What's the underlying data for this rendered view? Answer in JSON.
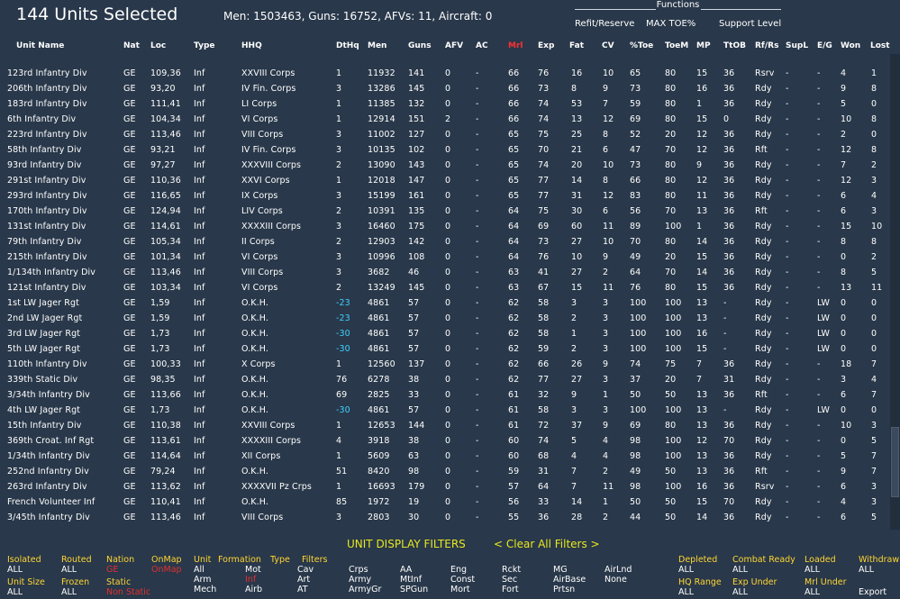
{
  "header": {
    "title": "144 Units Selected",
    "stats": "Men: 1503463, Guns: 16752, AFVs: 11, Aircraft: 0",
    "functions_label": "Functions",
    "functions": [
      "Refit/Reserve",
      "MAX TOE%",
      "Support Level"
    ]
  },
  "columns": [
    "Unit Name",
    "Nat",
    "Loc",
    "Type",
    "HHQ",
    "DtHq",
    "Men",
    "Guns",
    "AFV",
    "AC",
    "Mrl",
    "Exp",
    "Fat",
    "CV",
    "%Toe",
    "ToeM",
    "MP",
    "TtOB",
    "Rf/Rs",
    "SupL",
    "E/G",
    "Won",
    "Lost"
  ],
  "sorted_column": "Mrl",
  "rows": [
    [
      "123rd Infantry Div",
      "GE",
      "109,36",
      "Inf",
      "XXVIII Corps",
      "1",
      "11932",
      "141",
      "0",
      "-",
      "66",
      "76",
      "16",
      "10",
      "65",
      "80",
      "15",
      "36",
      "Rsrv",
      "-",
      "-",
      "4",
      "1"
    ],
    [
      "206th Infantry Div",
      "GE",
      "93,20",
      "Inf",
      "IV Fin. Corps",
      "3",
      "13286",
      "145",
      "0",
      "-",
      "66",
      "73",
      "8",
      "9",
      "73",
      "80",
      "16",
      "36",
      "Rdy",
      "-",
      "-",
      "9",
      "8"
    ],
    [
      "183rd Infantry Div",
      "GE",
      "111,41",
      "Inf",
      "LI Corps",
      "1",
      "11385",
      "132",
      "0",
      "-",
      "66",
      "74",
      "53",
      "7",
      "59",
      "80",
      "1",
      "36",
      "Rdy",
      "-",
      "-",
      "5",
      "0"
    ],
    [
      "6th Infantry Div",
      "GE",
      "104,34",
      "Inf",
      "VI Corps",
      "1",
      "12914",
      "151",
      "2",
      "-",
      "66",
      "74",
      "13",
      "12",
      "69",
      "80",
      "15",
      "0",
      "Rdy",
      "-",
      "-",
      "10",
      "8"
    ],
    [
      "223rd Infantry Div",
      "GE",
      "113,46",
      "Inf",
      "VIII Corps",
      "3",
      "11002",
      "127",
      "0",
      "-",
      "65",
      "75",
      "25",
      "8",
      "52",
      "20",
      "12",
      "36",
      "Rdy",
      "-",
      "-",
      "2",
      "0"
    ],
    [
      "58th Infantry Div",
      "GE",
      "93,21",
      "Inf",
      "IV Fin. Corps",
      "3",
      "10135",
      "102",
      "0",
      "-",
      "65",
      "70",
      "21",
      "6",
      "47",
      "70",
      "12",
      "36",
      "Rft",
      "-",
      "-",
      "12",
      "8"
    ],
    [
      "93rd Infantry Div",
      "GE",
      "97,27",
      "Inf",
      "XXXVIII Corps",
      "2",
      "13090",
      "143",
      "0",
      "-",
      "65",
      "74",
      "20",
      "10",
      "73",
      "80",
      "9",
      "36",
      "Rdy",
      "-",
      "-",
      "7",
      "2"
    ],
    [
      "291st Infantry Div",
      "GE",
      "110,36",
      "Inf",
      "XXVI Corps",
      "1",
      "12018",
      "147",
      "0",
      "-",
      "65",
      "77",
      "14",
      "8",
      "66",
      "80",
      "12",
      "36",
      "Rdy",
      "-",
      "-",
      "12",
      "3"
    ],
    [
      "293rd Infantry Div",
      "GE",
      "116,65",
      "Inf",
      "IX Corps",
      "3",
      "15199",
      "161",
      "0",
      "-",
      "65",
      "77",
      "31",
      "12",
      "83",
      "80",
      "11",
      "36",
      "Rdy",
      "-",
      "-",
      "6",
      "4"
    ],
    [
      "170th Infantry Div",
      "GE",
      "124,94",
      "Inf",
      "LIV Corps",
      "2",
      "10391",
      "135",
      "0",
      "-",
      "64",
      "75",
      "30",
      "6",
      "56",
      "70",
      "13",
      "36",
      "Rft",
      "-",
      "-",
      "6",
      "3"
    ],
    [
      "131st Infantry Div",
      "GE",
      "114,61",
      "Inf",
      "XXXXIII Corps",
      "3",
      "16460",
      "175",
      "0",
      "-",
      "64",
      "69",
      "60",
      "11",
      "89",
      "100",
      "1",
      "36",
      "Rdy",
      "-",
      "-",
      "15",
      "10"
    ],
    [
      "79th Infantry Div",
      "GE",
      "105,34",
      "Inf",
      "II Corps",
      "2",
      "12903",
      "142",
      "0",
      "-",
      "64",
      "73",
      "27",
      "10",
      "70",
      "80",
      "14",
      "36",
      "Rdy",
      "-",
      "-",
      "8",
      "8"
    ],
    [
      "215th Infantry Div",
      "GE",
      "101,34",
      "Inf",
      "VI Corps",
      "3",
      "10996",
      "108",
      "0",
      "-",
      "64",
      "76",
      "10",
      "9",
      "49",
      "20",
      "15",
      "36",
      "Rdy",
      "-",
      "-",
      "0",
      "2"
    ],
    [
      "1/134th Infantry Div",
      "GE",
      "113,46",
      "Inf",
      "VIII Corps",
      "3",
      "3682",
      "46",
      "0",
      "-",
      "63",
      "41",
      "27",
      "2",
      "64",
      "70",
      "14",
      "36",
      "Rdy",
      "-",
      "-",
      "8",
      "5"
    ],
    [
      "121st Infantry Div",
      "GE",
      "103,34",
      "Inf",
      "VI Corps",
      "2",
      "13249",
      "145",
      "0",
      "-",
      "63",
      "67",
      "15",
      "11",
      "76",
      "80",
      "15",
      "36",
      "Rdy",
      "-",
      "-",
      "13",
      "11"
    ],
    [
      "1st LW Jager Rgt",
      "GE",
      "1,59",
      "Inf",
      "O.K.H.",
      "-23",
      "4861",
      "57",
      "0",
      "-",
      "62",
      "58",
      "3",
      "3",
      "100",
      "100",
      "13",
      "-",
      "Rdy",
      "-",
      "LW",
      "0",
      "0"
    ],
    [
      "2nd LW Jager Rgt",
      "GE",
      "1,59",
      "Inf",
      "O.K.H.",
      "-23",
      "4861",
      "57",
      "0",
      "-",
      "62",
      "58",
      "2",
      "3",
      "100",
      "100",
      "13",
      "-",
      "Rdy",
      "-",
      "LW",
      "0",
      "0"
    ],
    [
      "3rd LW Jager Rgt",
      "GE",
      "1,73",
      "Inf",
      "O.K.H.",
      "-30",
      "4861",
      "57",
      "0",
      "-",
      "62",
      "58",
      "1",
      "3",
      "100",
      "100",
      "16",
      "-",
      "Rdy",
      "-",
      "LW",
      "0",
      "0"
    ],
    [
      "5th LW Jager Rgt",
      "GE",
      "1,73",
      "Inf",
      "O.K.H.",
      "-30",
      "4861",
      "57",
      "0",
      "-",
      "62",
      "59",
      "2",
      "3",
      "100",
      "100",
      "15",
      "-",
      "Rdy",
      "-",
      "LW",
      "0",
      "0"
    ],
    [
      "110th Infantry Div",
      "GE",
      "100,33",
      "Inf",
      "X Corps",
      "1",
      "12560",
      "137",
      "0",
      "-",
      "62",
      "66",
      "26",
      "9",
      "74",
      "75",
      "7",
      "36",
      "Rdy",
      "-",
      "-",
      "18",
      "7"
    ],
    [
      "339th Static Div",
      "GE",
      "98,35",
      "Inf",
      "O.K.H.",
      "76",
      "6278",
      "38",
      "0",
      "-",
      "62",
      "77",
      "27",
      "3",
      "37",
      "20",
      "7",
      "31",
      "Rdy",
      "-",
      "-",
      "3",
      "4"
    ],
    [
      "3/34th Infantry Div",
      "GE",
      "113,66",
      "Inf",
      "O.K.H.",
      "69",
      "2825",
      "33",
      "0",
      "-",
      "61",
      "32",
      "9",
      "1",
      "50",
      "50",
      "13",
      "36",
      "Rft",
      "-",
      "-",
      "6",
      "7"
    ],
    [
      "4th LW Jager Rgt",
      "GE",
      "1,73",
      "Inf",
      "O.K.H.",
      "-30",
      "4861",
      "57",
      "0",
      "-",
      "61",
      "58",
      "3",
      "3",
      "100",
      "100",
      "13",
      "-",
      "Rdy",
      "-",
      "LW",
      "0",
      "0"
    ],
    [
      "15th Infantry Div",
      "GE",
      "110,38",
      "Inf",
      "XXVIII Corps",
      "1",
      "12653",
      "144",
      "0",
      "-",
      "61",
      "72",
      "37",
      "9",
      "69",
      "80",
      "13",
      "36",
      "Rdy",
      "-",
      "-",
      "10",
      "3"
    ],
    [
      "369th Croat. Inf Rgt",
      "GE",
      "113,61",
      "Inf",
      "XXXXIII Corps",
      "4",
      "3918",
      "38",
      "0",
      "-",
      "60",
      "74",
      "5",
      "4",
      "98",
      "100",
      "12",
      "70",
      "Rdy",
      "-",
      "-",
      "0",
      "5"
    ],
    [
      "1/34th Infantry Div",
      "GE",
      "114,64",
      "Inf",
      "XII Corps",
      "1",
      "5609",
      "63",
      "0",
      "-",
      "60",
      "68",
      "4",
      "4",
      "98",
      "100",
      "13",
      "36",
      "Rdy",
      "-",
      "-",
      "5",
      "7"
    ],
    [
      "252nd Infantry Div",
      "GE",
      "79,24",
      "Inf",
      "O.K.H.",
      "51",
      "8420",
      "98",
      "0",
      "-",
      "59",
      "31",
      "7",
      "2",
      "49",
      "50",
      "13",
      "36",
      "Rft",
      "-",
      "-",
      "9",
      "7"
    ],
    [
      "263rd Infantry Div",
      "GE",
      "113,62",
      "Inf",
      "XXXXVII Pz Crps",
      "1",
      "16693",
      "179",
      "0",
      "-",
      "57",
      "64",
      "7",
      "11",
      "98",
      "100",
      "16",
      "36",
      "Rsrv",
      "-",
      "-",
      "6",
      "3"
    ],
    [
      "French Volunteer Inf",
      "GE",
      "110,41",
      "Inf",
      "O.K.H.",
      "85",
      "1972",
      "19",
      "0",
      "-",
      "56",
      "33",
      "14",
      "1",
      "50",
      "50",
      "15",
      "70",
      "Rdy",
      "-",
      "-",
      "4",
      "3"
    ],
    [
      "3/45th Infantry Div",
      "GE",
      "113,46",
      "Inf",
      "VIII Corps",
      "3",
      "2803",
      "30",
      "0",
      "-",
      "55",
      "36",
      "28",
      "2",
      "44",
      "50",
      "14",
      "36",
      "Rdy",
      "-",
      "-",
      "6",
      "5"
    ]
  ],
  "filters": {
    "title": "UNIT DISPLAY FILTERS",
    "clear": "< Clear All Filters >",
    "isolated": {
      "label": "Isolated",
      "value": "ALL"
    },
    "routed": {
      "label": "Routed",
      "value": "ALL"
    },
    "nation": {
      "label": "Nation",
      "value": "GE"
    },
    "onmap": {
      "label": "OnMap",
      "value": "OnMap"
    },
    "unit_size": {
      "label": "Unit Size",
      "value": "ALL"
    },
    "frozen": {
      "label": "Frozen",
      "value": "ALL"
    },
    "static": {
      "label": "Static",
      "value": "Non Static"
    },
    "unit_header": "Unit",
    "formation_header": "Formation",
    "type_header": "Type",
    "filters_header": "Filters",
    "unit_opts": [
      "All",
      "Arm",
      "Mech"
    ],
    "formation_opts": [
      "Mot",
      "Inf",
      "Airb"
    ],
    "type_opts": [
      "Cav",
      "Art",
      "AT"
    ],
    "opts_a": [
      "Crps",
      "Army",
      "ArmyGr"
    ],
    "opts_b": [
      "AA",
      "MtInf",
      "SPGun"
    ],
    "opts_c": [
      "Eng",
      "Const",
      "Mort"
    ],
    "opts_d": [
      "Rckt",
      "Sec",
      "Fort"
    ],
    "opts_e": [
      "MG",
      "AirBase",
      "Prtsn"
    ],
    "opts_f": [
      "AirLnd",
      "None"
    ],
    "depleted": {
      "label": "Depleted",
      "value": "ALL"
    },
    "combat_ready": {
      "label": "Combat Ready",
      "value": "ALL"
    },
    "loaded": {
      "label": "Loaded",
      "value": "ALL"
    },
    "withdraw": {
      "label": "Withdraw",
      "value": "ALL"
    },
    "hq_range": {
      "label": "HQ Range",
      "value": "ALL"
    },
    "exp_under": {
      "label": "Exp Under",
      "value": "ALL"
    },
    "mrl_under": {
      "label": "Mrl Under",
      "value": "ALL"
    },
    "export": "Export"
  }
}
